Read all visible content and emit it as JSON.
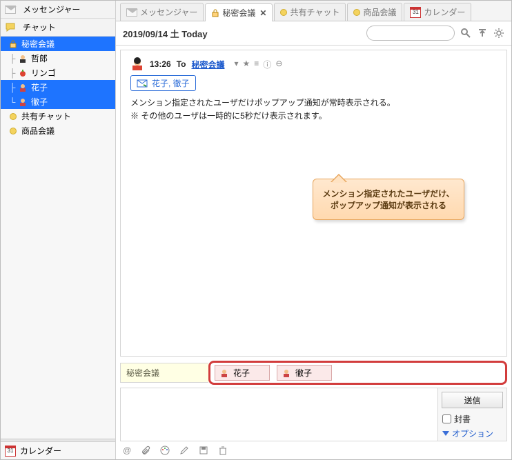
{
  "sidebar": {
    "messenger_label": "メッセンジャー",
    "chat_label": "チャット",
    "calendar_label": "カレンダー",
    "cal_num": "31",
    "tree": {
      "room": "秘密会議",
      "members": [
        "哲郎",
        "リンゴ",
        "花子",
        "徹子"
      ],
      "shared": "共有チャット",
      "product": "商品会議"
    }
  },
  "tabs": [
    {
      "icon": "envelope-icon",
      "label": "メッセンジャー"
    },
    {
      "icon": "lock-icon",
      "label": "秘密会議",
      "closable": true,
      "active": true
    },
    {
      "icon": "dot-icon",
      "label": "共有チャット"
    },
    {
      "icon": "dot-icon",
      "label": "商品会議"
    },
    {
      "icon": "calendar-icon",
      "label": "カレンダー"
    }
  ],
  "datebar": {
    "date": "2019/09/14 土 Today"
  },
  "message": {
    "time": "13:26",
    "to_label": "To",
    "to_room": "秘密会議",
    "mentions": "花子, 徹子",
    "body1": "メンション指定されたユーザだけポップアップ通知が常時表示される。",
    "body2": "※ その他のユーザは一時的に5秒だけ表示されます。"
  },
  "callout": {
    "line1": "メンション指定されたユーザだけ、",
    "line2": "ポップアップ通知が表示される"
  },
  "chips": {
    "label": "秘密会議",
    "items": [
      "花子",
      "徹子"
    ]
  },
  "compose": {
    "send": "送信",
    "sealed": "封書",
    "options": "オプション"
  }
}
